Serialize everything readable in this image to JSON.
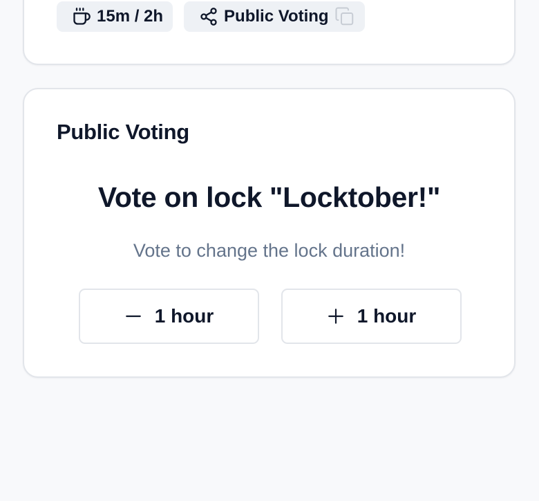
{
  "top_card": {
    "break_chip": {
      "icon": "coffee-cup-icon",
      "label": "15m / 2h"
    },
    "share_chip": {
      "icon": "share-icon",
      "label": "Public Voting",
      "copy_icon": "copy-icon"
    }
  },
  "voting_card": {
    "title": "Public Voting",
    "heading": "Vote on lock \"Locktober!\"",
    "subtitle": "Vote to change the lock duration!",
    "buttons": [
      {
        "icon": "minus-icon",
        "label": "1 hour"
      },
      {
        "icon": "plus-icon",
        "label": "1 hour"
      }
    ]
  },
  "colors": {
    "background": "#f8f9fb",
    "card": "#ffffff",
    "border": "#e2e5ea",
    "chip": "#eef1f5",
    "text": "#0f172a",
    "muted": "#64748b"
  }
}
